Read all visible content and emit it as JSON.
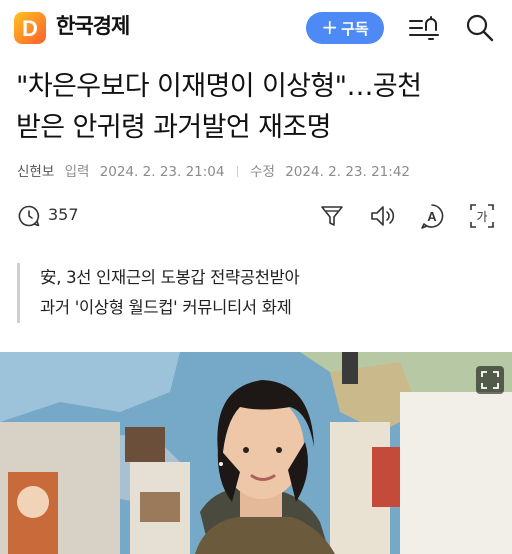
{
  "header": {
    "brand_name": "한국경제",
    "logo_letter": "D",
    "subscribe_label": "구독",
    "subscribe_plus": "+",
    "icons": [
      "menu-alarm-icon",
      "search-icon"
    ]
  },
  "article": {
    "title_line1": "\"차은우보다 이재명이 이상형\"…공천",
    "title_line2": "받은 안귀령 과거발언 재조명",
    "reporter": "신현보",
    "input_label": "입력",
    "input_date": "2024. 2. 23. 21:04",
    "modified_label": "수정",
    "modified_date": "2024. 2. 23. 21:42",
    "comment_count": "357",
    "summary_line1": "安, 3선 인재근의 도봉갑 전략공천받아",
    "summary_line2": "과거 '이상형 월드컵' 커뮤니티서 화제"
  },
  "tools": {
    "icons": [
      "comment-icon",
      "filter-icon",
      "listen-icon",
      "translate-icon",
      "font-size-icon"
    ],
    "translate_glyph": "A",
    "font_size_glyph": "가"
  },
  "colors": {
    "accent": "#4d8af5",
    "logo_gradient": [
      "#ffb21a",
      "#ff6a2b"
    ],
    "meta_text": "#8c8c8c",
    "summary_bar": "#cfcfcf"
  }
}
